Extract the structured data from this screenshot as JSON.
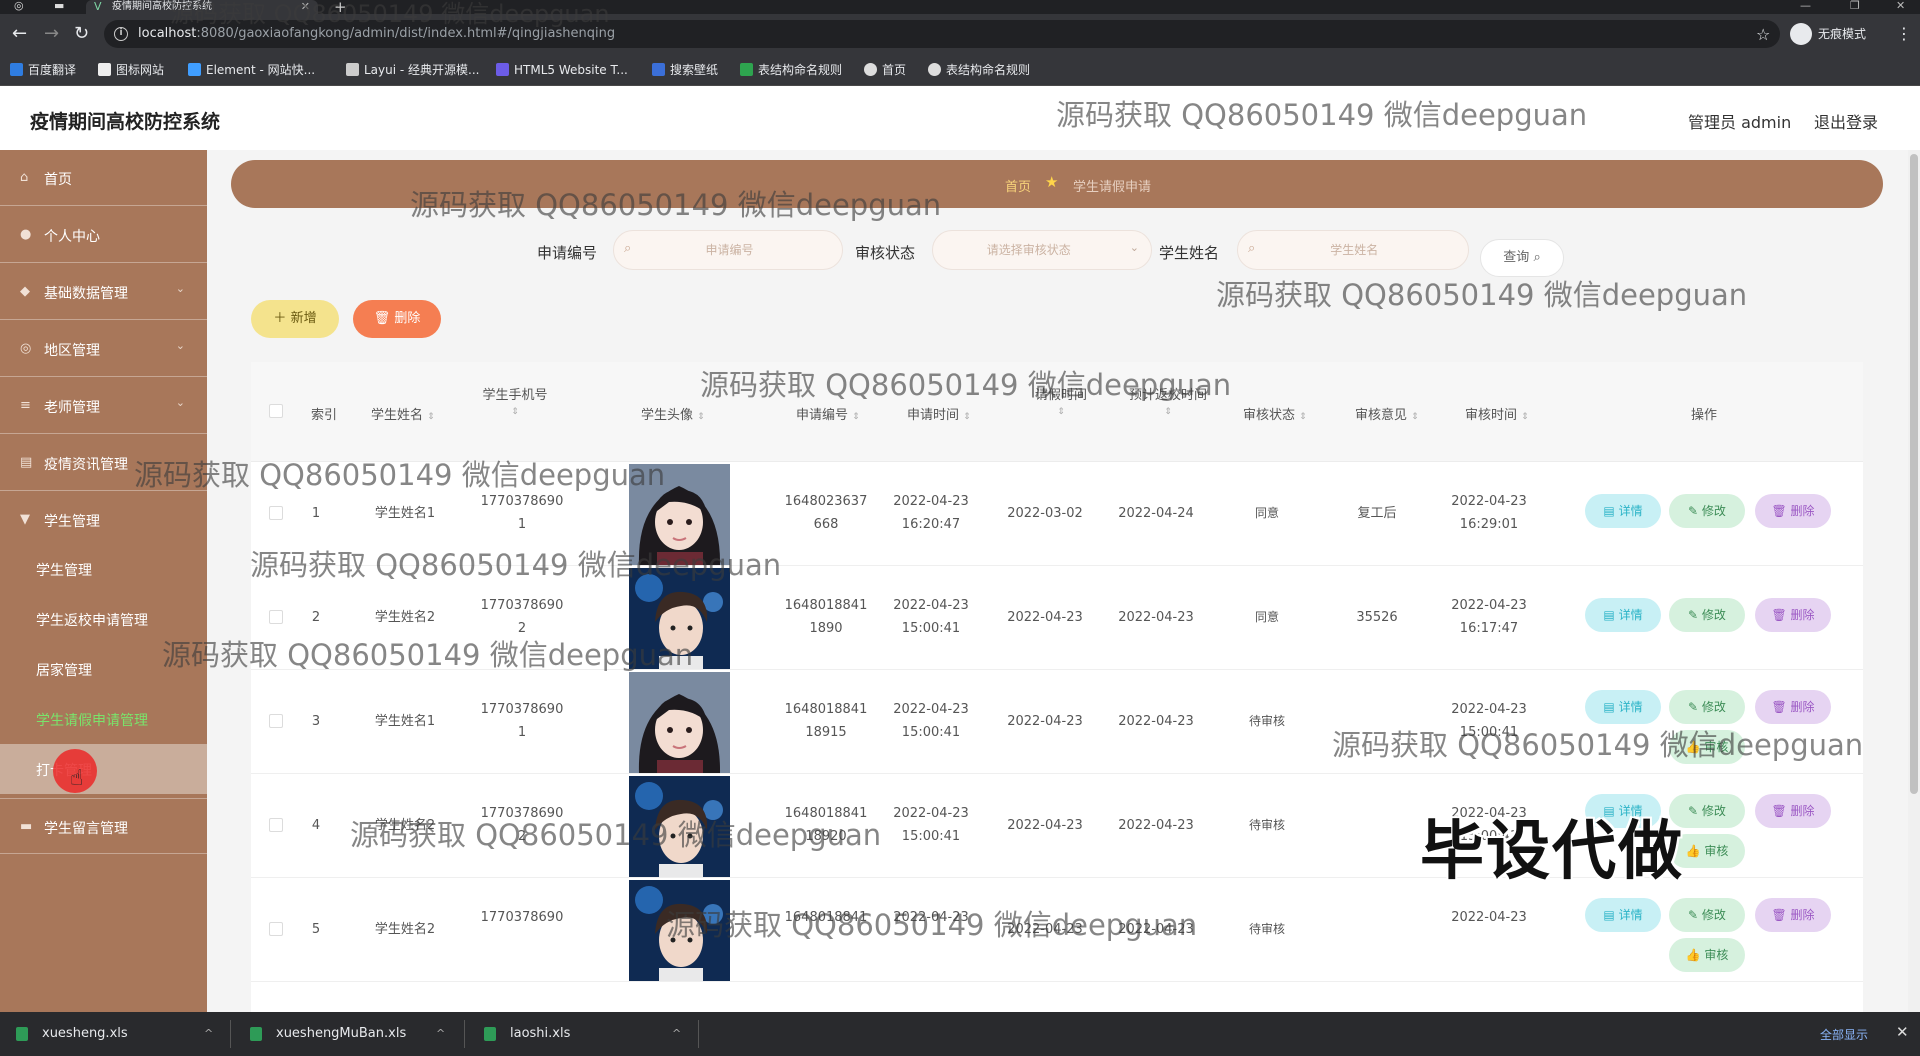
{
  "browser": {
    "tab_title": "疫情期间高校防控系统",
    "url_host": "localhost",
    "url_rest": ":8080/gaoxiaofangkong/admin/dist/index.html#/qingjiashenqing",
    "incognito_label": "无痕模式",
    "bookmarks": [
      "百度翻译",
      "图标网站",
      "Element - 网站快...",
      "Layui - 经典开源模...",
      "HTML5 Website T...",
      "搜索壁纸",
      "表结构命名规则",
      "首页",
      "表结构命名规则"
    ]
  },
  "header": {
    "title": "疫情期间高校防控系统",
    "admin": "管理员 admin",
    "logout": "退出登录"
  },
  "sidebar": {
    "items": [
      {
        "label": "首页"
      },
      {
        "label": "个人中心"
      },
      {
        "label": "基础数据管理"
      },
      {
        "label": "地区管理"
      },
      {
        "label": "老师管理"
      },
      {
        "label": "疫情资讯管理"
      },
      {
        "label": "学生管理"
      }
    ],
    "sub_items": [
      {
        "label": "学生管理"
      },
      {
        "label": "学生返校申请管理"
      },
      {
        "label": "居家管理"
      },
      {
        "label": "学生请假申请管理"
      },
      {
        "label": "打卡管理"
      }
    ],
    "last_item": "学生留言管理"
  },
  "breadcrumb": {
    "home": "首页",
    "current": "学生请假申请"
  },
  "search": {
    "field1_label": "申请编号",
    "field1_placeholder": "申请编号",
    "field2_label": "审核状态",
    "field2_placeholder": "请选择审核状态",
    "field3_label": "学生姓名",
    "field3_placeholder": "学生姓名",
    "query_label": "查询"
  },
  "actions": {
    "add": "新增",
    "delete": "删除"
  },
  "table": {
    "headers": {
      "index": "索引",
      "name": "学生姓名",
      "phone": "学生手机号",
      "avatar": "学生头像",
      "apply_no": "申请编号",
      "apply_time": "申请时间",
      "leave_time": "请假时间",
      "return_time": "预计返校时间",
      "status": "审核状态",
      "opinion": "审核意见",
      "audit_time": "审核时间",
      "ops": "操作"
    },
    "rows": [
      {
        "index": "1",
        "name": "学生姓名1",
        "phone": "17703786901",
        "apply_no": "1648023637668",
        "apply_date": "2022-04-23",
        "apply_clock": "16:20:47",
        "leave": "2022-03-02",
        "ret": "2022-04-24",
        "status": "同意",
        "opinion": "复工后",
        "audit_date": "2022-04-23",
        "audit_clock": "16:29:01"
      },
      {
        "index": "2",
        "name": "学生姓名2",
        "phone": "17703786902",
        "apply_no": "16480188411890",
        "apply_date": "2022-04-23",
        "apply_clock": "15:00:41",
        "leave": "2022-04-23",
        "ret": "2022-04-23",
        "status": "同意",
        "opinion": "35526",
        "audit_date": "2022-04-23",
        "audit_clock": "16:17:47"
      },
      {
        "index": "3",
        "name": "学生姓名1",
        "phone": "17703786901",
        "apply_no": "164801884118915",
        "apply_date": "2022-04-23",
        "apply_clock": "15:00:41",
        "leave": "2022-04-23",
        "ret": "2022-04-23",
        "status": "待审核",
        "opinion": "",
        "audit_date": "2022-04-23",
        "audit_clock": "15:00:41"
      },
      {
        "index": "4",
        "name": "学生姓名2",
        "phone": "17703786902",
        "apply_no": "164801884118920",
        "apply_date": "2022-04-23",
        "apply_clock": "15:00:41",
        "leave": "2022-04-23",
        "ret": "2022-04-23",
        "status": "待审核",
        "opinion": "",
        "audit_date": "2022-04-23",
        "audit_clock": "15:00:41"
      },
      {
        "index": "5",
        "name": "学生姓名2",
        "phone": "1770378690",
        "apply_no": "1648018841",
        "apply_date": "2022-04-23",
        "apply_clock": "",
        "leave": "2022-04-23",
        "ret": "2022-04-23",
        "status": "待审核",
        "opinion": "",
        "audit_date": "2022-04-23",
        "audit_clock": ""
      }
    ],
    "op_labels": {
      "detail": "详情",
      "edit": "修改",
      "delete": "删除",
      "audit": "审核"
    }
  },
  "watermark": "源码获取 QQ86050149 微信deepguan",
  "overlay_text": "毕设代做",
  "downloads": {
    "files": [
      "xuesheng.xls",
      "xueshengMuBan.xls",
      "laoshi.xls"
    ],
    "show_all": "全部显示"
  },
  "colors": {
    "brand_brown": "#a8775a",
    "active_green": "#7ae36b",
    "add_yellow": "#f4e38d",
    "delete_orange": "#f57e52"
  }
}
